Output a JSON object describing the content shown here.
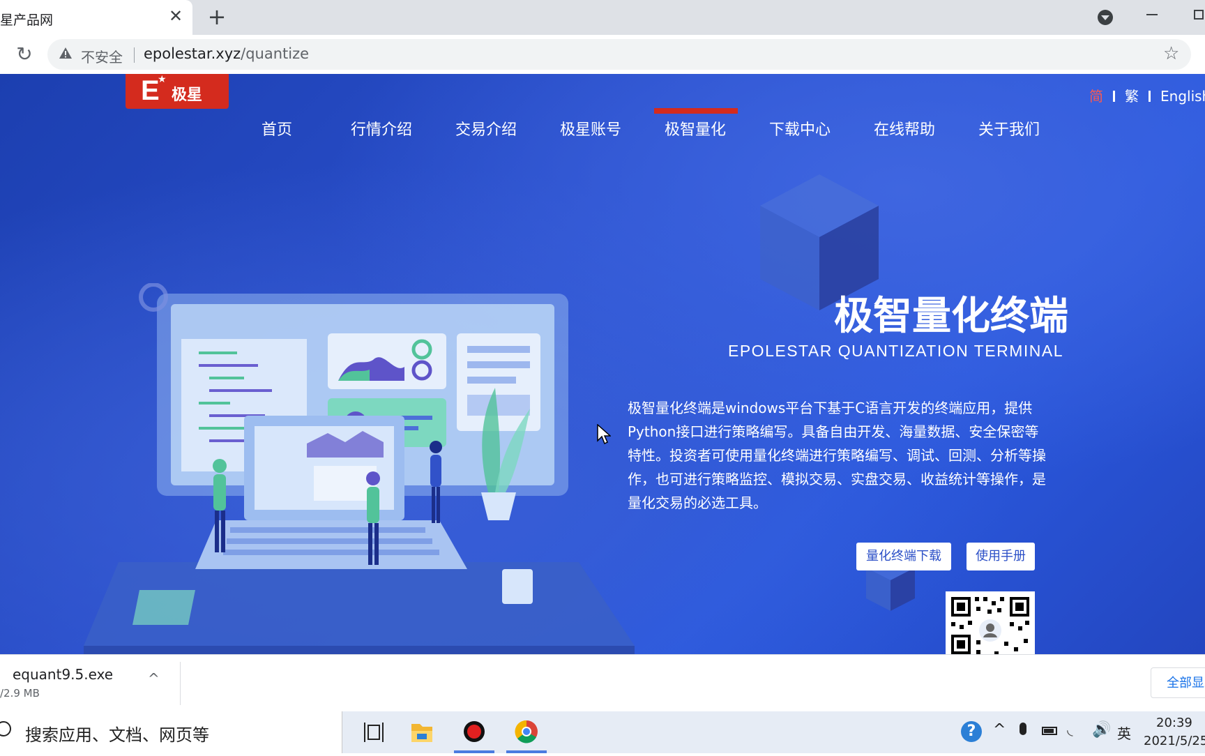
{
  "browser": {
    "tab_title": "星产品网",
    "close_glyph": "✕",
    "new_tab_glyph": "+",
    "reload_glyph": "↻",
    "security_label": "不安全",
    "url_host": "epolestar.xyz",
    "url_path": "/quantize",
    "bookmark_glyph": "☆"
  },
  "site": {
    "logo_letter": "E",
    "logo_star": "★",
    "logo_name": "极星",
    "languages": [
      {
        "label": "简",
        "active": true
      },
      {
        "label": "繁",
        "active": false
      },
      {
        "label": "English",
        "active": false
      }
    ],
    "nav": [
      {
        "label": "首页",
        "active": false
      },
      {
        "label": "行情介绍",
        "active": false
      },
      {
        "label": "交易介绍",
        "active": false
      },
      {
        "label": "极星账号",
        "active": false
      },
      {
        "label": "极智量化",
        "active": true
      },
      {
        "label": "下载中心",
        "active": false
      },
      {
        "label": "在线帮助",
        "active": false
      },
      {
        "label": "关于我们",
        "active": false
      }
    ],
    "accent_color": "#d42b1e",
    "hero": {
      "title": "极智量化终端",
      "subtitle": "EPOLESTAR QUANTIZATION TERMINAL",
      "description": "极智量化终端是windows平台下基于C语言开发的终端应用，提供Python接口进行策略编写。具备自由开发、海量数据、安全保密等特性。投资者可使用量化终端进行策略编写、调试、回测、分析等操作，也可进行策略监控、模拟交易、实盘交易、收益统计等操作，是量化交易的必选工具。",
      "download_button": "量化终端下载",
      "manual_button": "使用手册"
    }
  },
  "download_bar": {
    "file_name": "equant9.5.exe",
    "file_size": "/2.9 MB",
    "chevron_glyph": "^",
    "show_all": "全部显示"
  },
  "taskbar": {
    "search_placeholder": "搜索应用、文档、网页等",
    "tray": {
      "help_glyph": "?",
      "up_glyph": "^",
      "wifi_glyph": "◟",
      "volume_glyph": "🔊",
      "ime": "英",
      "time": "20:39",
      "date": "2021/5/25"
    }
  }
}
